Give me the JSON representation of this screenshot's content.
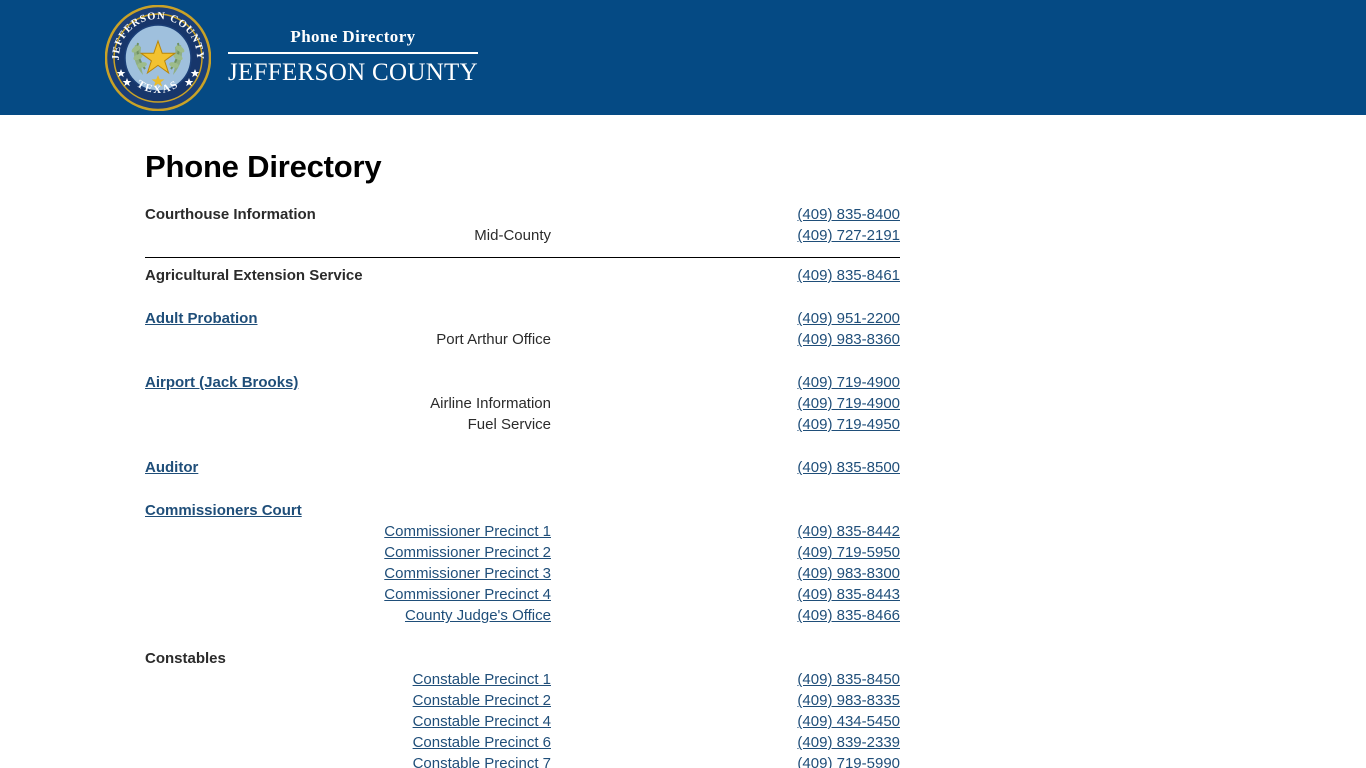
{
  "header": {
    "seal_text_top": "JEFFERSON COUNTY",
    "seal_text_bottom": "TEXAS",
    "subtitle": "Phone Directory",
    "title": "JEFFERSON COUNTY",
    "background_color": "#054a84"
  },
  "page": {
    "title": "Phone Directory",
    "link_color": "#1f4e79",
    "text_color": "#2b2b2b"
  },
  "sections": [
    {
      "heading": "Courthouse Information",
      "heading_is_link": false,
      "heading_phone": "(409) 835-8400",
      "divider_after": true,
      "items": [
        {
          "label": "Mid-County",
          "label_is_link": false,
          "phone": "(409) 727-2191"
        }
      ]
    },
    {
      "heading": "Agricultural Extension Service",
      "heading_is_link": false,
      "heading_phone": "(409) 835-8461",
      "divider_after": false,
      "items": []
    },
    {
      "heading": "Adult Probation",
      "heading_is_link": true,
      "heading_phone": "(409) 951-2200",
      "divider_after": false,
      "items": [
        {
          "label": "Port Arthur Office",
          "label_is_link": false,
          "phone": "(409) 983-8360"
        }
      ]
    },
    {
      "heading": "Airport (Jack Brooks)",
      "heading_is_link": true,
      "heading_phone": "(409) 719-4900",
      "divider_after": false,
      "items": [
        {
          "label": "Airline Information",
          "label_is_link": false,
          "phone": "(409) 719-4900"
        },
        {
          "label": "Fuel Service",
          "label_is_link": false,
          "phone": "(409) 719-4950"
        }
      ]
    },
    {
      "heading": "Auditor",
      "heading_is_link": true,
      "heading_phone": "(409) 835-8500",
      "divider_after": false,
      "items": []
    },
    {
      "heading": "Commissioners Court",
      "heading_is_link": true,
      "heading_phone": "",
      "divider_after": false,
      "items": [
        {
          "label": "Commissioner Precinct 1",
          "label_is_link": true,
          "phone": "(409) 835-8442"
        },
        {
          "label": "Commissioner Precinct 2",
          "label_is_link": true,
          "phone": "(409) 719-5950"
        },
        {
          "label": "Commissioner Precinct 3",
          "label_is_link": true,
          "phone": "(409) 983-8300"
        },
        {
          "label": "Commissioner Precinct 4",
          "label_is_link": true,
          "phone": "(409) 835-8443"
        },
        {
          "label": "County Judge's Office",
          "label_is_link": true,
          "phone": "(409) 835-8466"
        }
      ]
    },
    {
      "heading": "Constables",
      "heading_is_link": false,
      "heading_phone": "",
      "divider_after": false,
      "items": [
        {
          "label": "Constable Precinct 1",
          "label_is_link": true,
          "phone": "(409) 835-8450"
        },
        {
          "label": "Constable Precinct 2",
          "label_is_link": true,
          "phone": "(409) 983-8335"
        },
        {
          "label": "Constable Precinct 4",
          "label_is_link": true,
          "phone": "(409) 434-5450"
        },
        {
          "label": "Constable Precinct 6",
          "label_is_link": true,
          "phone": "(409) 839-2339"
        },
        {
          "label": "Constable Precinct 7",
          "label_is_link": true,
          "phone": "(409) 719-5990"
        }
      ]
    }
  ]
}
